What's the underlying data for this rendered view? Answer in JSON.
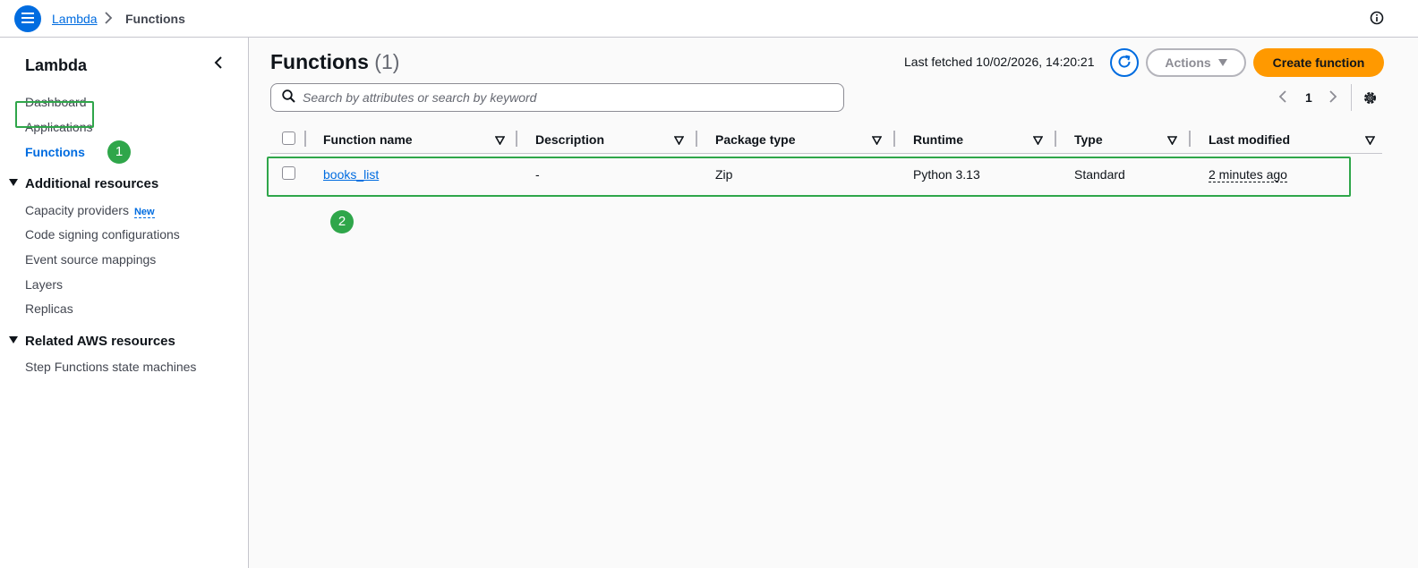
{
  "topbar": {
    "breadcrumb_root": "Lambda",
    "breadcrumb_current": "Functions",
    "icons": [
      "menu-icon",
      "chevron-right-icon",
      "info-icon"
    ]
  },
  "sidebar": {
    "title": "Lambda",
    "items": [
      {
        "label": "Dashboard"
      },
      {
        "label": "Applications"
      },
      {
        "label": "Functions",
        "active": true
      }
    ],
    "sections": [
      {
        "label": "Additional resources",
        "items": [
          {
            "label": "Capacity providers",
            "badge": "New"
          },
          {
            "label": "Code signing configurations"
          },
          {
            "label": "Event source mappings"
          },
          {
            "label": "Layers"
          },
          {
            "label": "Replicas"
          }
        ]
      },
      {
        "label": "Related AWS resources",
        "items": [
          {
            "label": "Step Functions state machines"
          }
        ]
      }
    ]
  },
  "markers": {
    "one": "1",
    "two": "2"
  },
  "main": {
    "title": "Functions",
    "count": "(1)",
    "last_fetched": "Last fetched 10/02/2026, 14:20:21",
    "actions_label": "Actions",
    "create_label": "Create function",
    "search_placeholder": "Search by attributes or search by keyword",
    "page_number": "1"
  },
  "table": {
    "columns": [
      "Function name",
      "Description",
      "Package type",
      "Runtime",
      "Type",
      "Last modified"
    ],
    "rows": [
      {
        "function_name": "books_list",
        "description": "-",
        "package_type": "Zip",
        "runtime": "Python 3.13",
        "type": "Standard",
        "last_modified": "2 minutes ago"
      }
    ]
  },
  "colors": {
    "primary_blue": "#006ce0",
    "create_orange": "#ff9900",
    "highlight_green": "#2fa64a"
  }
}
